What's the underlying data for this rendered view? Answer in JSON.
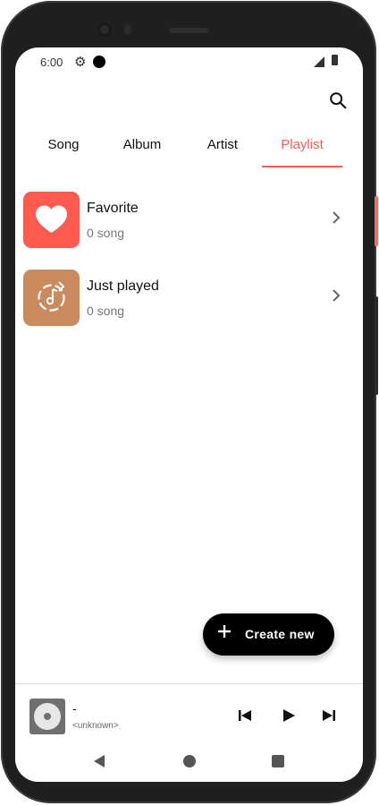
{
  "status": {
    "time": "6:00"
  },
  "tabs": [
    {
      "label": "Song"
    },
    {
      "label": "Album"
    },
    {
      "label": "Artist"
    },
    {
      "label": "Playlist"
    }
  ],
  "active_tab": "Playlist",
  "playlists": [
    {
      "title": "Favorite",
      "subtitle": "0 song",
      "color": "#ff5a4e",
      "icon": "heart-icon"
    },
    {
      "title": "Just played",
      "subtitle": "0 song",
      "color": "#c98a5e",
      "icon": "music-history-icon"
    }
  ],
  "fab": {
    "label": "Create new"
  },
  "player": {
    "title": "-",
    "artist": "<unknown>"
  },
  "colors": {
    "accent": "#ff5a4e",
    "fab": "#000000",
    "recent": "#c98a5e"
  }
}
